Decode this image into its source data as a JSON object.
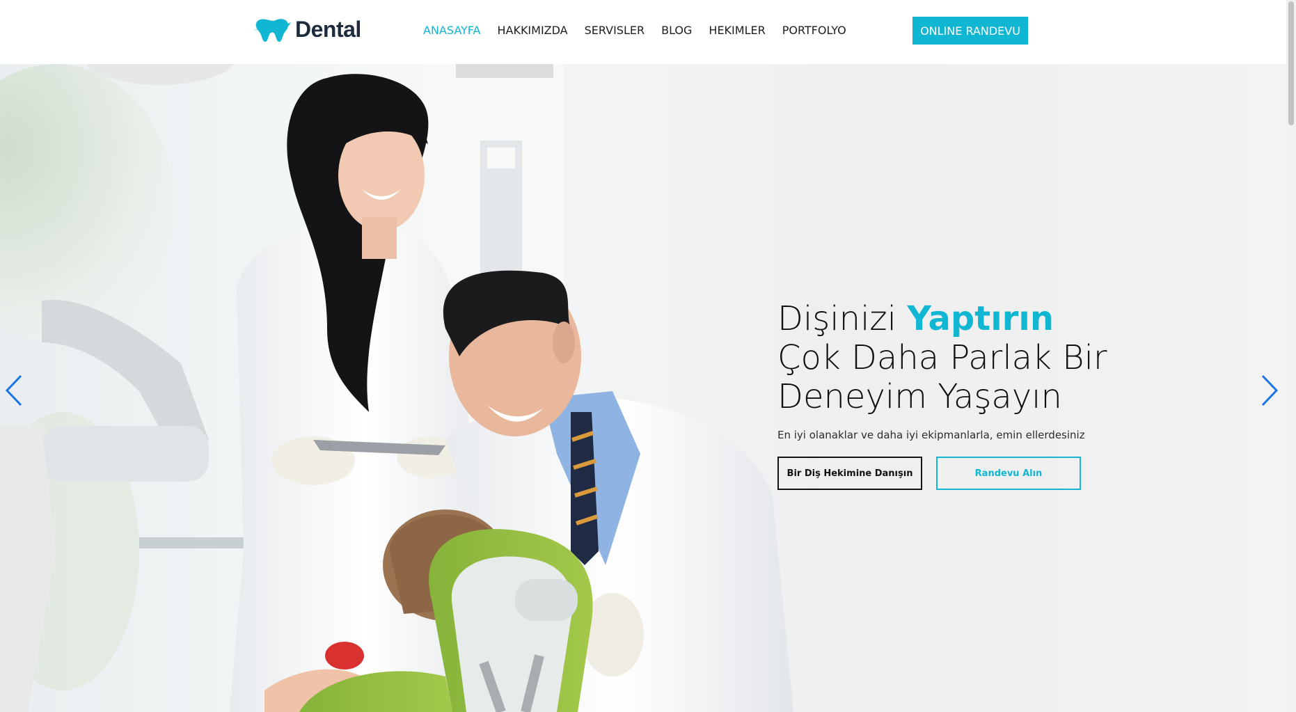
{
  "brand": {
    "name": "Dental",
    "accent_color": "#11b6d3",
    "text_color": "#1e2b3c"
  },
  "nav": {
    "items": [
      {
        "label": "ANASAYFA",
        "active": true
      },
      {
        "label": "HAKKIMIZDA",
        "active": false
      },
      {
        "label": "SERVISLER",
        "active": false
      },
      {
        "label": "BLOG",
        "active": false
      },
      {
        "label": "HEKIMLER",
        "active": false
      },
      {
        "label": "PORTFOLYO",
        "active": false
      }
    ],
    "cta_label": "ONLINE RANDEVU"
  },
  "hero": {
    "title_part1": "Dişinizi ",
    "title_accent": "Yaptırın",
    "title_line2": "Çok Daha Parlak Bir",
    "title_line3": "Deneyim Yaşayın",
    "subtitle": "En iyi olanaklar ve daha iyi ekipmanlarla, emin ellerdesiniz",
    "button_primary": "Bir Diş Hekimine Danışın",
    "button_secondary": "Randevu Alın",
    "prev_icon": "chevron-left-icon",
    "next_icon": "chevron-right-icon"
  }
}
